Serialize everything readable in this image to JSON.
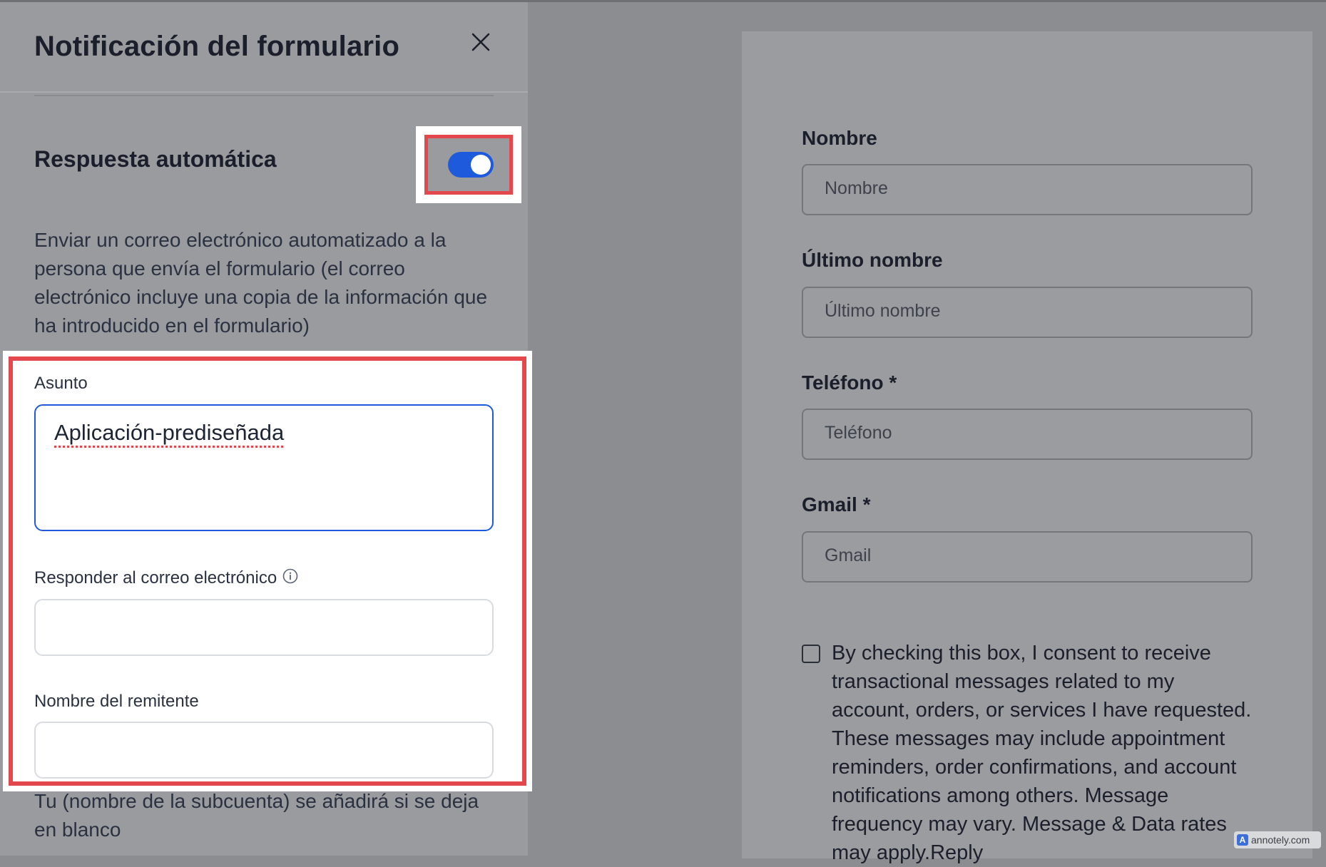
{
  "panel": {
    "title": "Notificación del formulario",
    "auto_reply": {
      "title": "Respuesta automática",
      "enabled": true,
      "description": "Enviar un correo electrónico automatizado a la persona que envía el formulario (el correo electrónico incluye una copia de la información que ha introducido en el formulario)"
    },
    "fields": {
      "subject_label": "Asunto",
      "subject_value": "Aplicación-prediseñada",
      "reply_to_label": "Responder al correo electrónico",
      "reply_to_value": "",
      "sender_name_label": "Nombre del remitente",
      "sender_name_value": ""
    },
    "helper_text": "Tu (nombre de la subcuenta) se añadirá si se deja en blanco"
  },
  "preview": {
    "fields": [
      {
        "label": "Nombre",
        "placeholder": "Nombre"
      },
      {
        "label": "Último nombre",
        "placeholder": "Último nombre"
      },
      {
        "label": "Teléfono *",
        "placeholder": "Teléfono"
      },
      {
        "label": "Gmail *",
        "placeholder": "Gmail"
      }
    ],
    "consent_text": "By checking this box, I consent to receive transactional messages related to my account, orders, or services I have requested. These messages may include appointment reminders, order confirmations, and account notifications among others. Message frequency may vary. Message & Data rates may apply.Reply"
  },
  "watermark": {
    "badge": "A",
    "text": "annotely.com"
  },
  "colors": {
    "accent": "#1e5bdc",
    "highlight": "#e3484d"
  }
}
